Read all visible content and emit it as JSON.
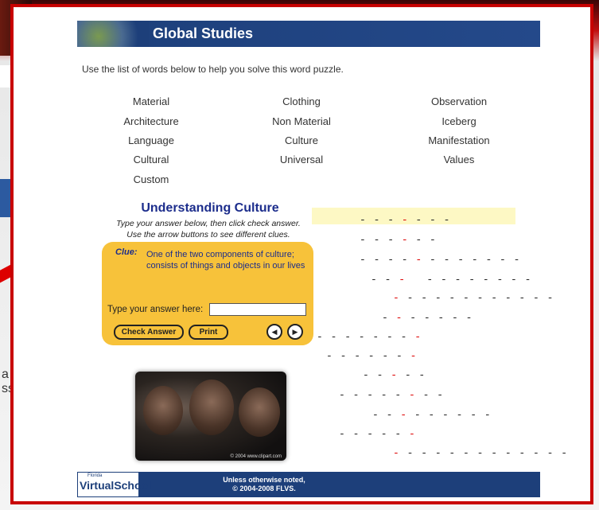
{
  "background": {
    "edge_text_1": "a",
    "edge_text_2": "ss"
  },
  "header": {
    "title": "Global Studies"
  },
  "instructions": "Use the list of words below to help you solve this word puzzle.",
  "word_bank": [
    "Material",
    "Clothing",
    "Observation",
    "Architecture",
    "Non Material",
    "Iceberg",
    "Language",
    "Culture",
    "Manifestation",
    "Cultural",
    "Universal",
    "Values",
    "Custom"
  ],
  "puzzle": {
    "title": "Understanding Culture",
    "subtitle_1": "Type your answer below, then click check answer.",
    "subtitle_2": "Use the arrow buttons to see different clues.",
    "clue_label": "Clue:",
    "clue_text": "One of the two components of culture; consists of things and objects in our lives",
    "answer_label": "Type your answer here:",
    "answer_value": "",
    "check_button": "Check Answer",
    "print_button": "Print",
    "prev_icon": "left-arrow-icon",
    "next_icon": "right-arrow-icon"
  },
  "photo": {
    "caption": "© 2004 www.clipart.com"
  },
  "footer": {
    "logo_small": "Florida",
    "logo_big": "VirtualSchool",
    "note_1": "Unless otherwise noted,",
    "note_2": "© 2004-2008 FLVS."
  },
  "colors": {
    "frame": "#c80000",
    "banner": "#1d3f7a",
    "clue_box": "#f7c23a",
    "title_blue": "#1c2d8c"
  }
}
